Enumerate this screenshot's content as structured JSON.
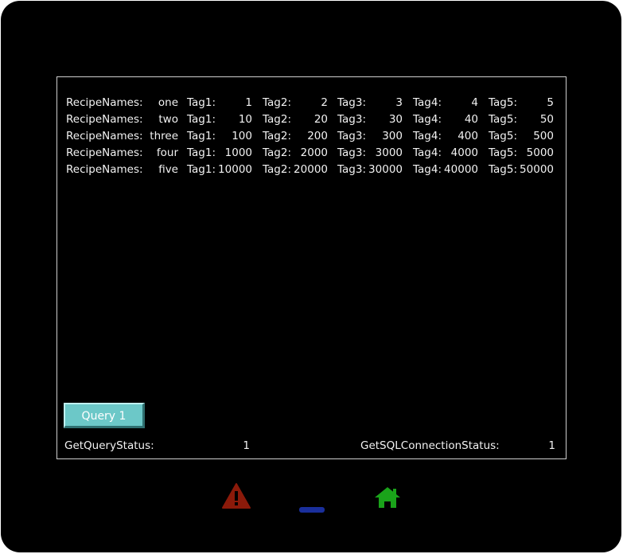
{
  "recipes": {
    "rows": [
      {
        "label": "RecipeNames:",
        "name": "one",
        "tags": [
          [
            "Tag1:",
            "1"
          ],
          [
            "Tag2:",
            "2"
          ],
          [
            "Tag3:",
            "3"
          ],
          [
            "Tag4:",
            "4"
          ],
          [
            "Tag5:",
            "5"
          ]
        ]
      },
      {
        "label": "RecipeNames:",
        "name": "two",
        "tags": [
          [
            "Tag1:",
            "10"
          ],
          [
            "Tag2:",
            "20"
          ],
          [
            "Tag3:",
            "30"
          ],
          [
            "Tag4:",
            "40"
          ],
          [
            "Tag5:",
            "50"
          ]
        ]
      },
      {
        "label": "RecipeNames:",
        "name": "three",
        "tags": [
          [
            "Tag1:",
            "100"
          ],
          [
            "Tag2:",
            "200"
          ],
          [
            "Tag3:",
            "300"
          ],
          [
            "Tag4:",
            "400"
          ],
          [
            "Tag5:",
            "500"
          ]
        ]
      },
      {
        "label": "RecipeNames:",
        "name": "four",
        "tags": [
          [
            "Tag1:",
            "1000"
          ],
          [
            "Tag2:",
            "2000"
          ],
          [
            "Tag3:",
            "3000"
          ],
          [
            "Tag4:",
            "4000"
          ],
          [
            "Tag5:",
            "5000"
          ]
        ]
      },
      {
        "label": "RecipeNames:",
        "name": "five",
        "tags": [
          [
            "Tag1:",
            "10000"
          ],
          [
            "Tag2:",
            "20000"
          ],
          [
            "Tag3:",
            "30000"
          ],
          [
            "Tag4:",
            "40000"
          ],
          [
            "Tag5:",
            "50000"
          ]
        ]
      }
    ]
  },
  "query_button": {
    "label": "Query 1"
  },
  "status": {
    "query_label": "GetQueryStatus:",
    "query_value": "1",
    "connection_label": "GetSQLConnectionStatus:",
    "connection_value": "1"
  },
  "nav": {
    "alarm_icon": "warning-icon",
    "alarm_color": "#8b1a0a",
    "minus_icon": "minimize-icon",
    "minus_color": "#1a2f9c",
    "home_icon": "home-icon",
    "home_color": "#1aa31a"
  }
}
